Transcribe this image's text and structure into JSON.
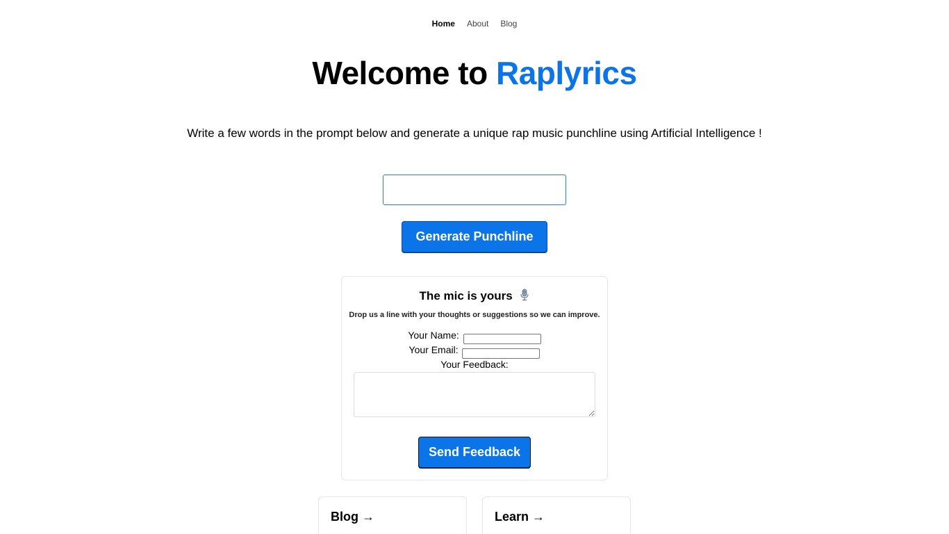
{
  "nav": {
    "items": [
      {
        "label": "Home",
        "active": true
      },
      {
        "label": "About",
        "active": false
      },
      {
        "label": "Blog",
        "active": false
      }
    ]
  },
  "hero": {
    "title_prefix": "Welcome to ",
    "title_brand": "Raplyrics",
    "subtitle": "Write a few words in the prompt below and generate a unique rap music punchline using Artificial Intelligence !"
  },
  "prompt": {
    "value": "",
    "button_label": "Generate Punchline"
  },
  "feedback": {
    "title": "The mic is yours",
    "icon": "microphone-icon",
    "description": "Drop us a line with your thoughts or suggestions so we can improve.",
    "name_label": "Your Name:",
    "email_label": "Your Email:",
    "feedback_label": "Your Feedback:",
    "send_label": "Send Feedback"
  },
  "cards": {
    "blog": "Blog →",
    "learn": "Learn →"
  },
  "colors": {
    "accent": "#0b74e8"
  }
}
